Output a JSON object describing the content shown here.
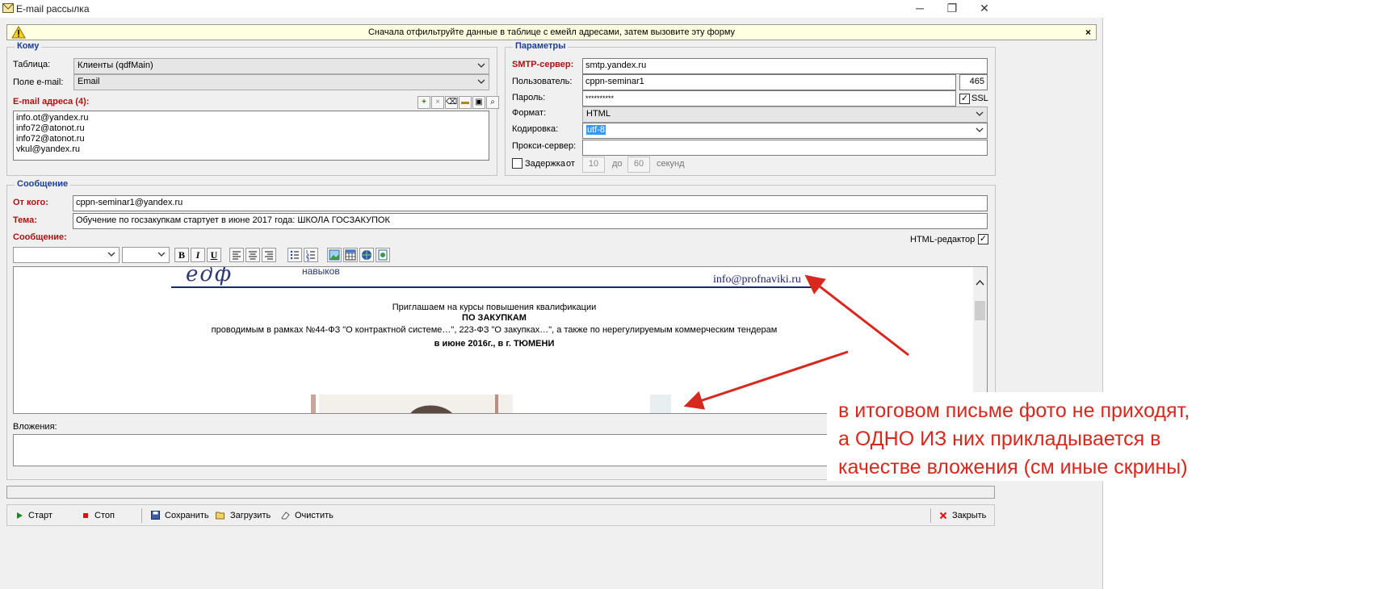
{
  "window": {
    "title": "E-mail рассылка",
    "minimize": "─",
    "maximize": "❐",
    "close": "✕"
  },
  "notice": {
    "text": "Сначала отфильтруйте данные в таблице с емейл адресами, затем вызовите эту форму",
    "close": "×"
  },
  "to_group": {
    "legend": "Кому",
    "table_label": "Таблица:",
    "table_value": "Клиенты (qdfMain)",
    "email_field_label": "Поле e-mail:",
    "email_field_value": "Email",
    "addresses_label": "E-mail адреса (4):",
    "addresses": [
      "info.ot@yandex.ru",
      "info72@atonot.ru",
      "info72@atonot.ru",
      "vkul@yandex.ru"
    ]
  },
  "params_group": {
    "legend": "Параметры",
    "smtp_label": "SMTP-сервер:",
    "smtp_value": "smtp.yandex.ru",
    "user_label": "Пользователь:",
    "user_value": "cppn-seminar1",
    "port_value": "465",
    "password_label": "Пароль:",
    "password_value": "**********",
    "ssl_label": "SSL",
    "ssl_checked": "✓",
    "format_label": "Формат:",
    "format_value": "HTML",
    "encoding_label": "Кодировка:",
    "encoding_value": "utf-8",
    "proxy_label": "Прокси-сервер:",
    "proxy_value": "",
    "delay_label": "Задержка",
    "delay_from": "от",
    "delay_from_value": "10",
    "delay_to": "до",
    "delay_to_value": "60",
    "delay_unit": "секунд"
  },
  "message_group": {
    "legend": "Сообщение",
    "from_label": "От кого:",
    "from_value": "cppn-seminar1@yandex.ru",
    "subject_label": "Тема:",
    "subject_value": "Обучение по госзакупкам стартует в июне 2017 года: ШКОЛА ГОСЗАКУПОК",
    "body_label": "Сообщение:",
    "html_editor_label": "HTML-редактор",
    "html_editor_checked": "✓",
    "toolbar": {
      "bold": "B",
      "italic": "I",
      "underline": "U"
    },
    "body": {
      "logo_text": "едф",
      "logo_sub": "навыков",
      "site": "info@profnaviki.ru",
      "line1": "Приглашаем на курсы повышения квалификации",
      "line2": "ПО ЗАКУПКАМ",
      "line3": "проводимым в рамках №44-ФЗ \"О контрактной системе…\",  223-ФЗ \"О закупках…\", а также по нерегулируемым коммерческим тендерам",
      "line4": "в июне 2016г., в г. ТЮМЕНИ"
    },
    "attachments_label": "Вложения:"
  },
  "bottom_toolbar": {
    "start": "Старт",
    "stop": "Стоп",
    "save": "Сохранить",
    "load": "Загрузить",
    "clear": "Очистить",
    "close": "Закрыть"
  },
  "annotation": {
    "line1": "в итоговом письме фото не приходят,",
    "line2": "а ОДНО ИЗ них прикладывается в",
    "line3": "качестве вложения (см иные скрины)",
    "color": "#d8281e"
  }
}
